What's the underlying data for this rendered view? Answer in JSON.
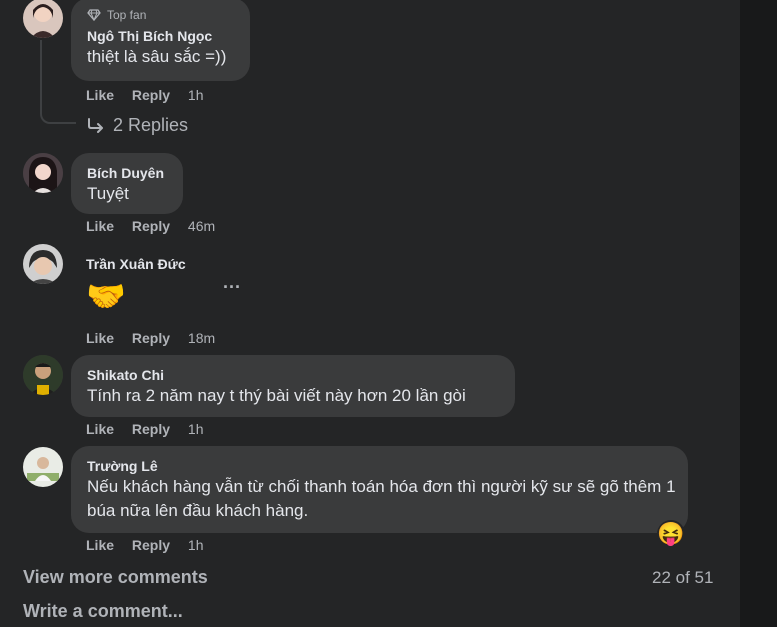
{
  "comments": [
    {
      "badge": "Top fan",
      "author": "Ngô Thị Bích Ngọc",
      "text": "thiệt là sâu sắc =))",
      "like": "Like",
      "reply": "Reply",
      "time": "1h",
      "replies_label": "2 Replies"
    },
    {
      "author": "Bích Duyên",
      "text": "Tuyệt",
      "like": "Like",
      "reply": "Reply",
      "time": "46m"
    },
    {
      "author": "Trần Xuân Đức",
      "text": "🤝",
      "like": "Like",
      "reply": "Reply",
      "time": "18m",
      "more": "..."
    },
    {
      "author": "Shikato Chi",
      "text": "Tính ra 2 năm nay t thý bài viết này hơn 20 lần gòi",
      "like": "Like",
      "reply": "Reply",
      "time": "1h"
    },
    {
      "author": "Trường Lê",
      "text": "Nếu khách hàng vẫn từ chối thanh toán hóa đơn thì người kỹ sư sẽ gõ thêm 1 búa nữa lên đầu khách hàng.",
      "like": "Like",
      "reply": "Reply",
      "time": "1h",
      "reaction": "😝"
    }
  ],
  "footer": {
    "view_more": "View more comments",
    "count": "22 of 51",
    "write": "Write a comment..."
  },
  "colors": {
    "background": "#242526",
    "bubble": "#3a3b3c",
    "text": "#e4e6eb",
    "secondary": "#b0b3b8"
  }
}
